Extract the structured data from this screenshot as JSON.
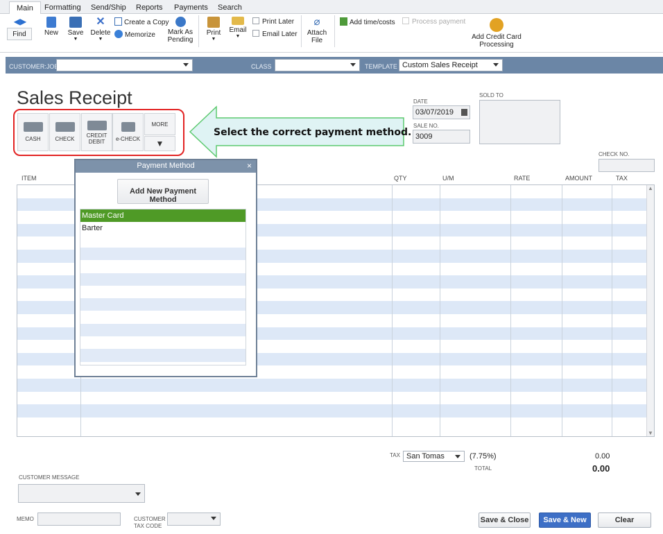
{
  "ribbon": {
    "tabs": [
      "Main",
      "Formatting",
      "Send/Ship",
      "Reports",
      "Payments",
      "Search"
    ],
    "find": "Find",
    "new": "New",
    "save": "Save",
    "delete": "Delete",
    "create_copy": "Create a Copy",
    "memorize": "Memorize",
    "mark_as": "Mark As",
    "pending": "Pending",
    "print": "Print",
    "email": "Email",
    "print_later": "Print Later",
    "email_later": "Email Later",
    "attach": "Attach",
    "file": "File",
    "add_time_costs": "Add time/costs",
    "process_payment": "Process payment",
    "add_cc_1": "Add Credit Card",
    "add_cc_2": "Processing"
  },
  "header": {
    "customer_job_label": "CUSTOMER:JOB",
    "class_label": "CLASS",
    "template_label": "TEMPLATE",
    "template_value": "Custom Sales Receipt"
  },
  "form": {
    "title": "Sales Receipt",
    "date_label": "DATE",
    "date_value": "03/07/2019",
    "sale_no_label": "SALE NO.",
    "sale_no_value": "3009",
    "sold_to_label": "SOLD TO",
    "check_no_label": "CHECK NO."
  },
  "payment_buttons": {
    "cash": "CASH",
    "check": "CHECK",
    "credit_1": "CREDIT",
    "credit_2": "DEBIT",
    "echeck": "e-CHECK",
    "more": "MORE"
  },
  "callout": "Select the correct payment method.",
  "grid": {
    "columns": [
      "ITEM",
      "QTY",
      "U/M",
      "RATE",
      "AMOUNT",
      "TAX"
    ]
  },
  "popup": {
    "title": "Payment Method",
    "close": "×",
    "add_new": "Add New Payment Method",
    "items": [
      "Master Card",
      "Barter"
    ]
  },
  "footer": {
    "tax_label": "TAX",
    "tax_item": "San Tomas",
    "tax_rate": "(7.75%)",
    "tax_amount": "0.00",
    "total_label": "TOTAL",
    "total_amount": "0.00",
    "customer_message_label": "CUSTOMER MESSAGE",
    "memo_label": "MEMO",
    "customer_tax_code_1": "CUSTOMER",
    "customer_tax_code_2": "TAX CODE",
    "save_close": "Save & Close",
    "save_new": "Save & New",
    "clear": "Clear"
  },
  "colors": {
    "band": "#6b86a6",
    "selected_item": "#4f9a26",
    "highlight_box": "#e22222",
    "callout_fill": "#dff3f4",
    "callout_border": "#5cc96f"
  }
}
